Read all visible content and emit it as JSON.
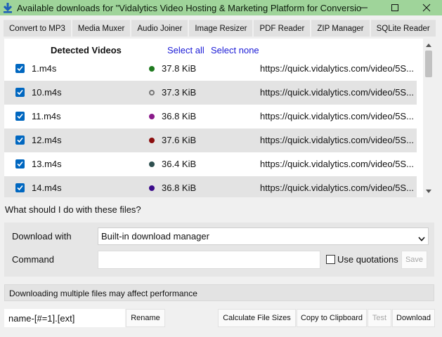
{
  "window": {
    "title": "Available downloads for \"Vidalytics Video Hosting & Marketing Platform for Conversion...",
    "accent": "#9fd49a"
  },
  "tabs": [
    {
      "label": "Convert to MP3"
    },
    {
      "label": "Media Muxer"
    },
    {
      "label": "Audio Joiner"
    },
    {
      "label": "Image Resizer"
    },
    {
      "label": "PDF Reader"
    },
    {
      "label": "ZIP Manager"
    },
    {
      "label": "SQLite Reader"
    }
  ],
  "list": {
    "header": "Detected Videos",
    "select_all": "Select all",
    "select_none": "Select none",
    "rows": [
      {
        "name": "1.m4s",
        "size": "37.8 KiB",
        "color": "#1f7a1f",
        "url": "https://quick.vidalytics.com/video/5S...",
        "checked": true
      },
      {
        "name": "10.m4s",
        "size": "37.3 KiB",
        "color": "#777777",
        "url": "https://quick.vidalytics.com/video/5S...",
        "checked": true
      },
      {
        "name": "11.m4s",
        "size": "36.8 KiB",
        "color": "#8a1a8a",
        "url": "https://quick.vidalytics.com/video/5S...",
        "checked": true
      },
      {
        "name": "12.m4s",
        "size": "37.6 KiB",
        "color": "#8b0e0e",
        "url": "https://quick.vidalytics.com/video/5S...",
        "checked": true
      },
      {
        "name": "13.m4s",
        "size": "36.4 KiB",
        "color": "#2f5050",
        "url": "https://quick.vidalytics.com/video/5S...",
        "checked": true
      },
      {
        "name": "14.m4s",
        "size": "36.8 KiB",
        "color": "#3a0a8a",
        "url": "https://quick.vidalytics.com/video/5S...",
        "checked": true
      }
    ]
  },
  "question": "What should I do with these files?",
  "options": {
    "download_with_label": "Download with",
    "download_with_value": "Built-in download manager",
    "command_label": "Command",
    "command_value": "",
    "use_quotations_label": "Use quotations",
    "use_quotations_checked": false,
    "save_label": "Save"
  },
  "notice": "Downloading multiple files may affect performance",
  "bottom": {
    "pattern_value": "name-[#=1].[ext]",
    "rename_label": "Rename",
    "calc_label": "Calculate File Sizes",
    "copy_label": "Copy to Clipboard",
    "test_label": "Test",
    "download_label": "Download"
  }
}
